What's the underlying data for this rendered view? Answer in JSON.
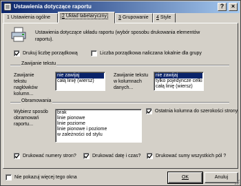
{
  "window": {
    "title": "Ustawienia dotyczące raportu",
    "btn_help": "?",
    "btn_close": "×"
  },
  "tabs": [
    {
      "num": "1",
      "label": "Ustawienia ogólne"
    },
    {
      "num": "2",
      "label": "Układ tabelaryczny"
    },
    {
      "num": "3",
      "label": "Grupowanie"
    },
    {
      "num": "4",
      "label": "Style"
    }
  ],
  "panel": {
    "description": "Ustawienia dotyczące układu raportu (wybór sposobu drukowania elementów raportu).",
    "print_row_number": {
      "label": "Drukuj liczbę porządkową",
      "checked": true
    },
    "local_numbering": {
      "label": "Liczba porządkowa naliczana lokalnie dla grupy",
      "checked": false
    },
    "wrap_section": "Zawijanie tekstu",
    "wrap_headers_label": "Zawijanie tekstu nagłówków kolumn...",
    "wrap_headers_options": [
      "nie zawijaj",
      "całą linię (wiersz)"
    ],
    "wrap_data_label": "Zawijanie tekstu w kolumnach danych...",
    "wrap_data_options": [
      "nie zawijaj",
      "tylko pojedyncze celki",
      "całą linię (wiersz)"
    ],
    "border_section": "Obramowania",
    "border_label": "Wybierz sposób obramowań raportu...",
    "border_options": [
      "brak",
      "linie pionowe",
      "linie poziome",
      "linie pionowe i poziome",
      "w zależności od stylu"
    ],
    "last_col_full_width": {
      "label": "Ostatnia kolumna do szerokości strony",
      "checked": true
    },
    "print_page_numbers": {
      "label": "Drukować numery stron?",
      "checked": true
    },
    "print_date_time": {
      "label": "Drukować datę i czas?",
      "checked": true
    },
    "print_totals": {
      "label": "Drukować sumy wszystkich pól ?",
      "checked": true
    }
  },
  "footer": {
    "dont_show": {
      "label": "Nie pokazuj więcej tego okna",
      "checked": false
    },
    "ok": "OK",
    "cancel": "Anuluj"
  }
}
